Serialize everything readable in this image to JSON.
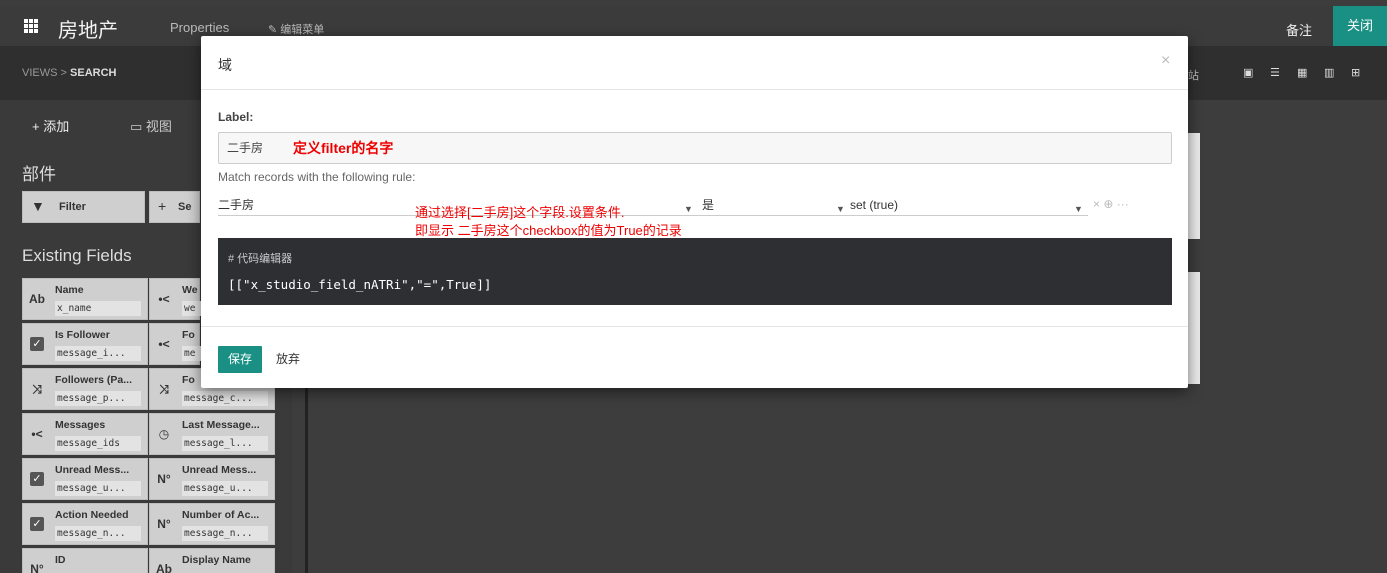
{
  "topbar": {
    "app_title": "房地产",
    "menu_properties": "Properties",
    "menu_edit": "✎ 编辑菜单",
    "notes": "备注",
    "close": "关闭"
  },
  "subbar": {
    "crumb_views": "VIEWS",
    "crumb_sep": ">",
    "crumb_search": "SEARCH",
    "site_fragment": "站"
  },
  "sidebar": {
    "tab_add": "+ 添加",
    "tab_view": "视图",
    "components_title": "部件",
    "filter_label": "Filter",
    "separator_label": "Se",
    "existing_title": "Existing Fields",
    "fields": [
      {
        "name": "Name",
        "tech": "x_name",
        "icon": "Ab"
      },
      {
        "name": "We",
        "tech": "we",
        "icon": "•<"
      },
      {
        "name": "Is Follower",
        "tech": "message_i...",
        "icon": "✓"
      },
      {
        "name": "Fo",
        "tech": "me",
        "icon": "•<"
      },
      {
        "name": "Followers (Pa...",
        "tech": "message_p...",
        "icon": "⤨"
      },
      {
        "name": "Fo",
        "tech": "message_c...",
        "icon": "⤨"
      },
      {
        "name": "Messages",
        "tech": "message_ids",
        "icon": "•<"
      },
      {
        "name": "Last Message...",
        "tech": "message_l...",
        "icon": "◷"
      },
      {
        "name": "Unread Mess...",
        "tech": "message_u...",
        "icon": "✓"
      },
      {
        "name": "Unread Mess...",
        "tech": "message_u...",
        "icon": "N°"
      },
      {
        "name": "Action Needed",
        "tech": "message_n...",
        "icon": "✓"
      },
      {
        "name": "Number of Ac...",
        "tech": "message_n...",
        "icon": "N°"
      },
      {
        "name": "ID",
        "tech": "",
        "icon": "N°"
      },
      {
        "name": "Display Name",
        "tech": "",
        "icon": "Ab"
      }
    ]
  },
  "modal": {
    "title": "域",
    "close": "×",
    "label_caption": "Label:",
    "label_value": "二手房",
    "annotation_name": "定义filter的名字",
    "rule_caption": "Match records with the following rule:",
    "rule_field": "二手房",
    "rule_operator": "是",
    "rule_value": "set (true)",
    "rule_actions": "×  ⊕  ···",
    "annotation_rule_1": "通过选择[二手房]这个字段.设置条件.",
    "annotation_rule_2": "即显示 二手房这个checkbox的值为True的记录",
    "code_title": "# 代码编辑器",
    "code_value": "[[\"x_studio_field_nATRi\",\"=\",True]]",
    "save": "保存",
    "discard": "放弃"
  }
}
